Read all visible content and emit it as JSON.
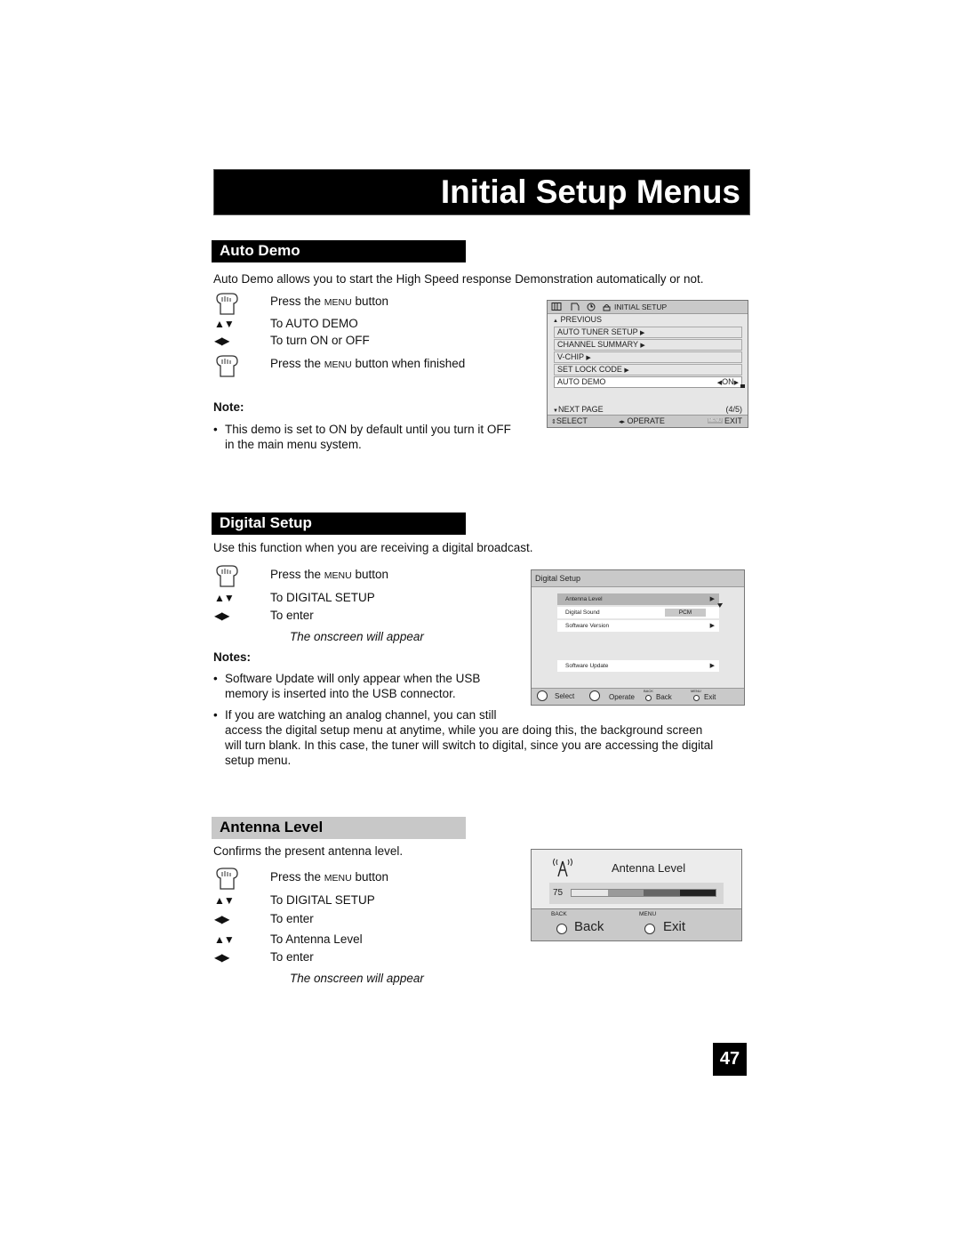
{
  "page_title": "Initial Setup Menus",
  "page_number": "47",
  "auto_demo": {
    "heading": "Auto Demo",
    "intro": "Auto Demo allows you to start the High Speed response Demonstration automatically or not.",
    "steps": [
      {
        "icon": "hand-press-icon",
        "pre": "Press the ",
        "sc": "Menu",
        "post": " button"
      },
      {
        "icon": "up-down-arrows-icon",
        "text": "To AUTO DEMO"
      },
      {
        "icon": "left-right-arrows-icon",
        "text": "To turn ON or OFF"
      },
      {
        "icon": "hand-press-icon",
        "pre": "Press the ",
        "sc": "Menu",
        "post": " button when finished"
      }
    ],
    "note_label": "Note:",
    "notes": [
      "This demo is set to ON by default until you turn it OFF",
      "in the main menu system."
    ],
    "screen": {
      "header": "INITIAL SETUP",
      "previous": "PREVIOUS",
      "items": [
        "AUTO TUNER SETUP",
        "CHANNEL SUMMARY",
        "V-CHIP",
        "SET LOCK CODE"
      ],
      "selected_item": "AUTO DEMO",
      "selected_value": "ON",
      "next_page": "NEXT PAGE",
      "page_indicator": "(4/5)",
      "footer": {
        "select": "SELECT",
        "operate": "OPERATE",
        "menu_tag": "MENU",
        "exit": "EXIT"
      }
    }
  },
  "digital_setup": {
    "heading": "Digital Setup",
    "intro": "Use this function when you are receiving a digital broadcast.",
    "steps": [
      {
        "icon": "hand-press-icon",
        "pre": "Press the ",
        "sc": "Menu",
        "post": " button"
      },
      {
        "icon": "up-down-arrows-icon",
        "text": "To DIGITAL SETUP"
      },
      {
        "icon": "left-right-arrows-icon",
        "text": "To enter"
      }
    ],
    "onscreen_note": "The onscreen will appear",
    "notes_label": "Notes:",
    "notes": [
      {
        "lines": [
          "Software Update will only appear when the USB",
          "memory is inserted into the USB connector."
        ]
      },
      {
        "lines": [
          "If you are watching an analog channel, you can still",
          "access the digital setup menu at anytime, while you are doing this, the background screen",
          "will turn blank.  In this case, the tuner will switch to digital, since you are accessing the digital",
          "setup menu."
        ]
      }
    ],
    "screen": {
      "header": "Digital Setup",
      "items": [
        {
          "label": "Antenna Level",
          "value": "",
          "arrow": true
        },
        {
          "label": "Digital Sound",
          "value": "PCM",
          "arrow": false
        },
        {
          "label": "Software Version",
          "value": "",
          "arrow": true
        },
        {
          "label": "Software Update",
          "value": "",
          "arrow": true
        }
      ],
      "footer": {
        "select": "Select",
        "operate": "Operate",
        "back_tag": "BACK",
        "back": "Back",
        "menu_tag": "MENU",
        "exit": "Exit"
      }
    }
  },
  "antenna_level": {
    "heading": "Antenna Level",
    "intro": "Confirms the present antenna level.",
    "steps": [
      {
        "icon": "hand-press-icon",
        "pre": "Press the ",
        "sc": "Menu",
        "post": " button"
      },
      {
        "icon": "up-down-arrows-icon",
        "text": "To DIGITAL SETUP"
      },
      {
        "icon": "left-right-arrows-icon",
        "text": "To enter"
      },
      {
        "icon": "up-down-arrows-icon",
        "text": "To Antenna Level"
      },
      {
        "icon": "left-right-arrows-icon",
        "text": "To enter"
      }
    ],
    "onscreen_note": "The onscreen will appear",
    "screen": {
      "title": "Antenna Level",
      "level_value": "75",
      "level_percent": 75,
      "footer": {
        "back_tag": "BACK",
        "back": "Back",
        "menu_tag": "MENU",
        "exit": "Exit"
      }
    }
  }
}
